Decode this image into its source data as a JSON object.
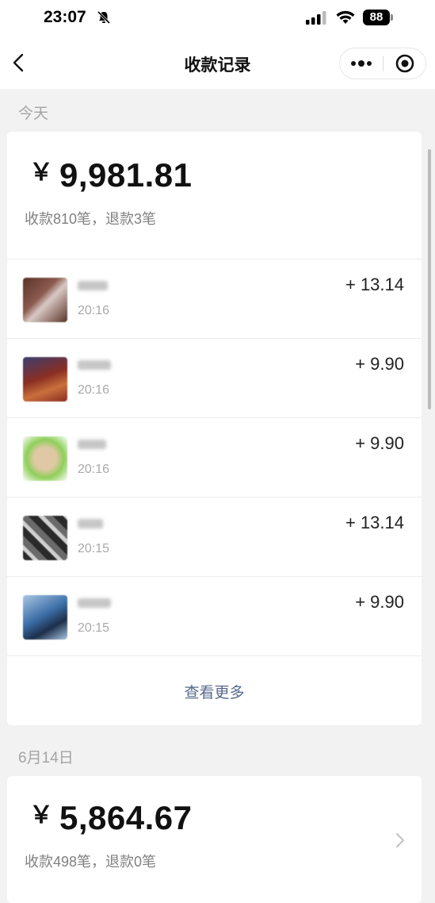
{
  "status_bar": {
    "time": "23:07",
    "battery": "88"
  },
  "nav": {
    "title": "收款记录"
  },
  "sections": [
    {
      "date_label": "今天",
      "total_currency": "￥",
      "total_amount": "9,981.81",
      "summary": "收款810笔，退款3笔",
      "records": [
        {
          "time": "20:16",
          "amount": "+ 13.14",
          "avatar_colors": [
            "#5a3328",
            "#d9c9c4",
            "#8b5a4f"
          ]
        },
        {
          "time": "20:16",
          "amount": "+ 9.90",
          "avatar_colors": [
            "#8a2e22",
            "#3a3f70",
            "#c9703c"
          ]
        },
        {
          "time": "20:16",
          "amount": "+ 9.90",
          "avatar_colors": [
            "#8fcf5a",
            "#e0c8a4",
            "#6bb83a"
          ]
        },
        {
          "time": "20:15",
          "amount": "+ 13.14",
          "avatar_colors": [
            "#2a2a2a",
            "#9a9a9a",
            "#d0d0d0"
          ]
        },
        {
          "time": "20:15",
          "amount": "+ 9.90",
          "avatar_colors": [
            "#3c6fa8",
            "#1d2f4a",
            "#a9c6e3"
          ]
        }
      ],
      "view_more": "查看更多"
    },
    {
      "date_label": "6月14日",
      "total_currency": "￥",
      "total_amount": "5,864.67",
      "summary": "收款498笔，退款0笔"
    }
  ]
}
